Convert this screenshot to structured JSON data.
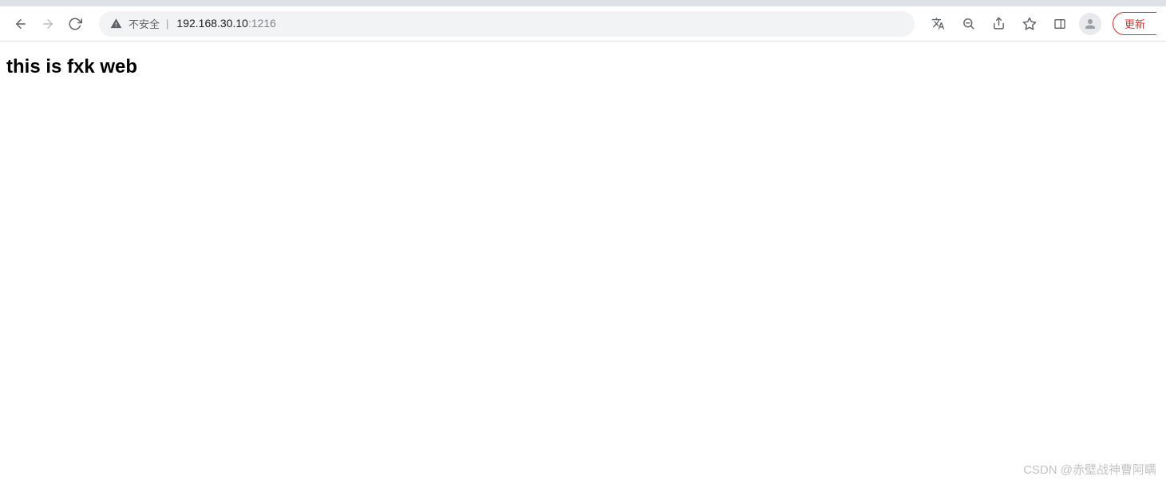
{
  "toolbar": {
    "security_label": "不安全",
    "url_host": "192.168.30.10",
    "url_port": ":1216",
    "update_label": "更新"
  },
  "page": {
    "heading": "this is fxk web"
  },
  "watermark": {
    "text": "CSDN @赤壁战神曹阿瞒"
  }
}
